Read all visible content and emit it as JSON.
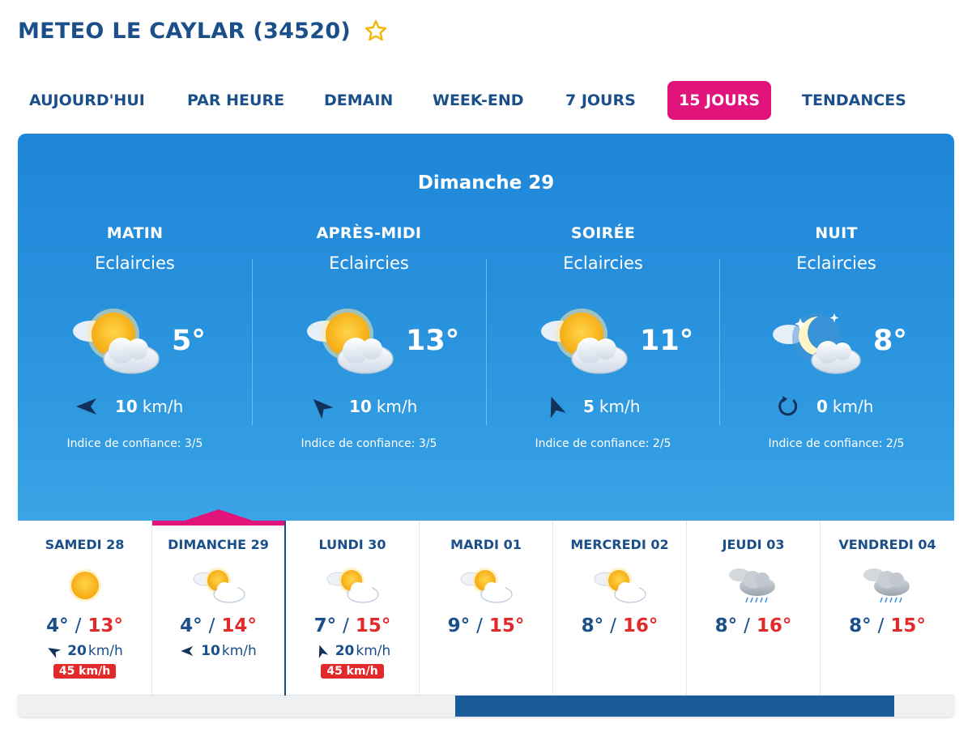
{
  "header": {
    "title": "METEO LE CAYLAR (34520)"
  },
  "tabs": [
    {
      "label": "AUJOURD'HUI"
    },
    {
      "label": "PAR HEURE"
    },
    {
      "label": "DEMAIN"
    },
    {
      "label": "WEEK-END"
    },
    {
      "label": "7 JOURS"
    },
    {
      "label": "15 JOURS",
      "active": true
    },
    {
      "label": "TENDANCES"
    }
  ],
  "detail": {
    "day": "Dimanche 29",
    "periods": [
      {
        "name": "MATIN",
        "condition": "Eclaircies",
        "icon": "sun-cloud-icon",
        "temp": "5°",
        "wind": "10",
        "wind_unit": "km/h",
        "confidence": "Indice de confiance: 3/5"
      },
      {
        "name": "APRÈS-MIDI",
        "condition": "Eclaircies",
        "icon": "sun-cloud-icon",
        "temp": "13°",
        "wind": "10",
        "wind_unit": "km/h",
        "confidence": "Indice de confiance: 3/5"
      },
      {
        "name": "SOIRÉE",
        "condition": "Eclaircies",
        "icon": "sun-cloud-icon",
        "temp": "11°",
        "wind": "5",
        "wind_unit": "km/h",
        "confidence": "Indice de confiance: 2/5"
      },
      {
        "name": "NUIT",
        "condition": "Eclaircies",
        "icon": "moon-cloud-icon",
        "temp": "8°",
        "wind": "0",
        "wind_unit": "km/h",
        "confidence": "Indice de confiance: 2/5"
      }
    ]
  },
  "days": [
    {
      "name": "SAMEDI 28",
      "icon": "sun-icon",
      "min": "4°",
      "max": "13°",
      "sep": "/",
      "wind": "20",
      "wind_unit": "km/h",
      "gust": "45 km/h"
    },
    {
      "name": "DIMANCHE 29",
      "icon": "sun-cloud-icon",
      "min": "4°",
      "max": "14°",
      "sep": "/",
      "wind": "10",
      "wind_unit": "km/h",
      "active": true
    },
    {
      "name": "LUNDI 30",
      "icon": "sun-cloud-icon",
      "min": "7°",
      "max": "15°",
      "sep": "/",
      "wind": "20",
      "wind_unit": "km/h",
      "gust": "45 km/h"
    },
    {
      "name": "MARDI 01",
      "icon": "sun-cloud-icon",
      "min": "9°",
      "max": "15°",
      "sep": "/"
    },
    {
      "name": "MERCREDI 02",
      "icon": "sun-cloud-icon",
      "min": "8°",
      "max": "16°",
      "sep": "/"
    },
    {
      "name": "JEUDI 03",
      "icon": "rain-cloud-icon",
      "min": "8°",
      "max": "16°",
      "sep": "/"
    },
    {
      "name": "VENDREDI 04",
      "icon": "rain-cloud-icon",
      "min": "8°",
      "max": "15°",
      "sep": "/"
    }
  ],
  "colors": {
    "brand": "#1b4f8a",
    "accent": "#e0147a",
    "max_temp": "#e22a2a",
    "panel": "#2a94de"
  }
}
